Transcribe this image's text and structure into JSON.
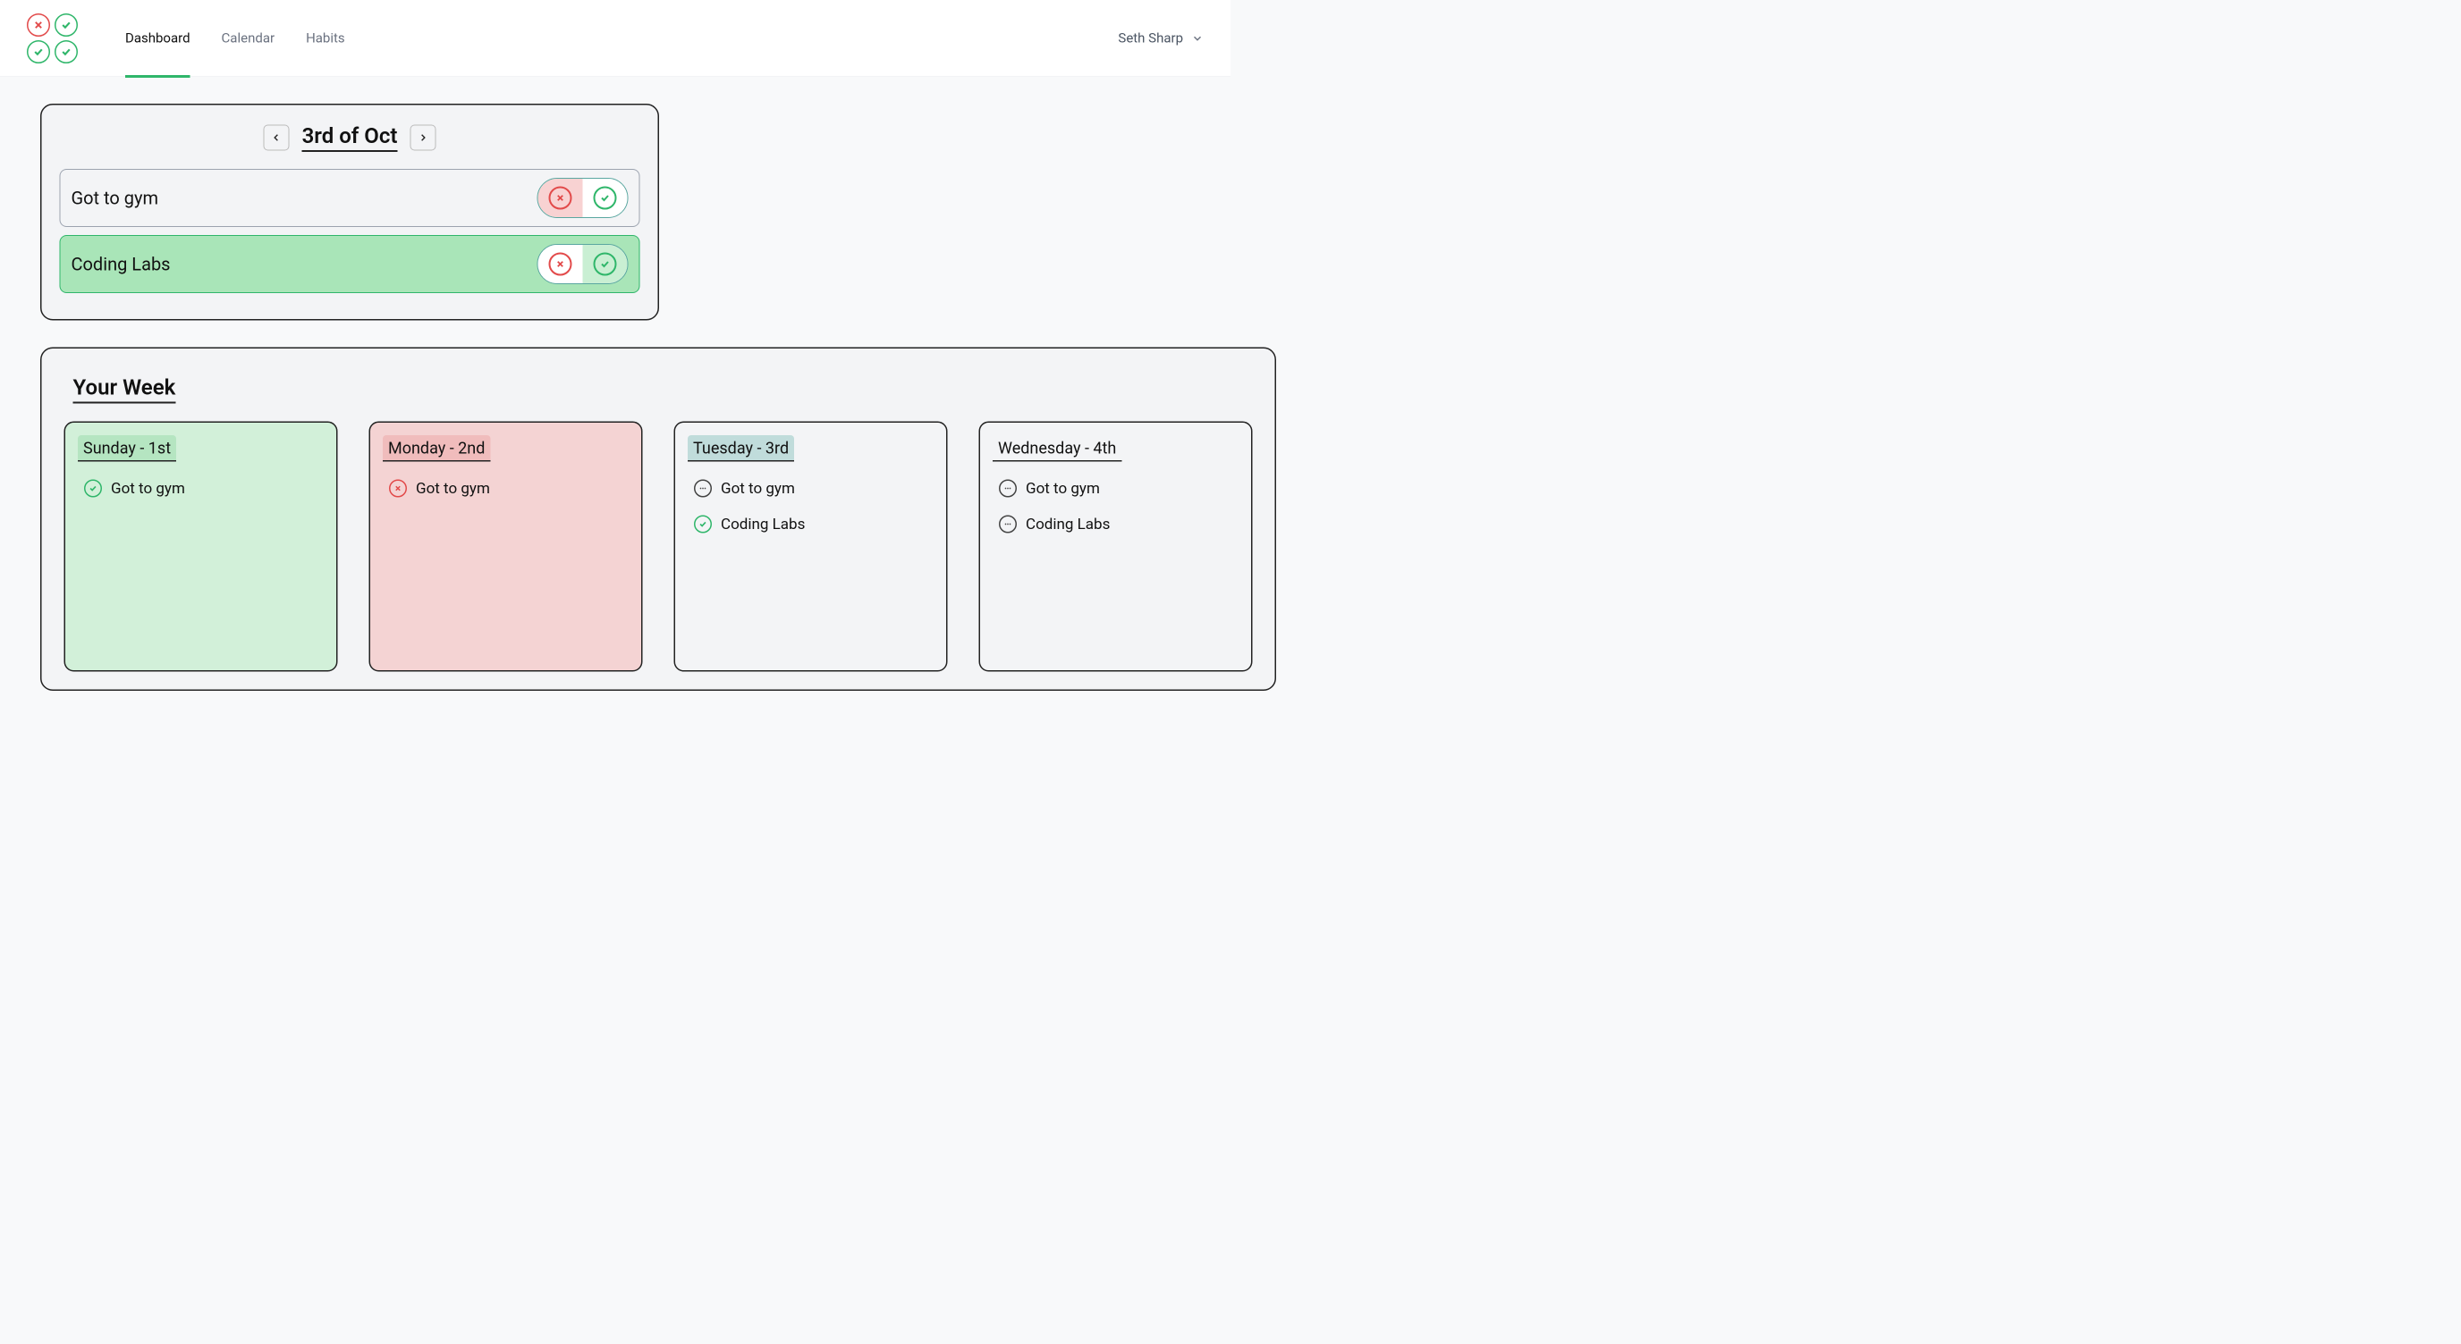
{
  "nav": {
    "items": [
      {
        "label": "Dashboard",
        "active": true
      },
      {
        "label": "Calendar",
        "active": false
      },
      {
        "label": "Habits",
        "active": false
      }
    ]
  },
  "user": {
    "name": "Seth Sharp"
  },
  "today": {
    "date_label": "3rd of Oct",
    "habits": [
      {
        "name": "Got to gym",
        "done": false,
        "x_highlighted": true
      },
      {
        "name": "Coding Labs",
        "done": true,
        "x_highlighted": false
      }
    ]
  },
  "week": {
    "title": "Your Week",
    "days": [
      {
        "label": "Sunday - 1st",
        "tone": "green",
        "entries": [
          {
            "name": "Got to gym",
            "status": "done"
          }
        ]
      },
      {
        "label": "Monday - 2nd",
        "tone": "red",
        "entries": [
          {
            "name": "Got to gym",
            "status": "missed"
          }
        ]
      },
      {
        "label": "Tuesday - 3rd",
        "tone": "teal",
        "entries": [
          {
            "name": "Got to gym",
            "status": "pending"
          },
          {
            "name": "Coding Labs",
            "status": "done"
          }
        ]
      },
      {
        "label": "Wednesday - 4th",
        "tone": "plain",
        "entries": [
          {
            "name": "Got to gym",
            "status": "pending"
          },
          {
            "name": "Coding Labs",
            "status": "pending"
          }
        ]
      }
    ]
  }
}
